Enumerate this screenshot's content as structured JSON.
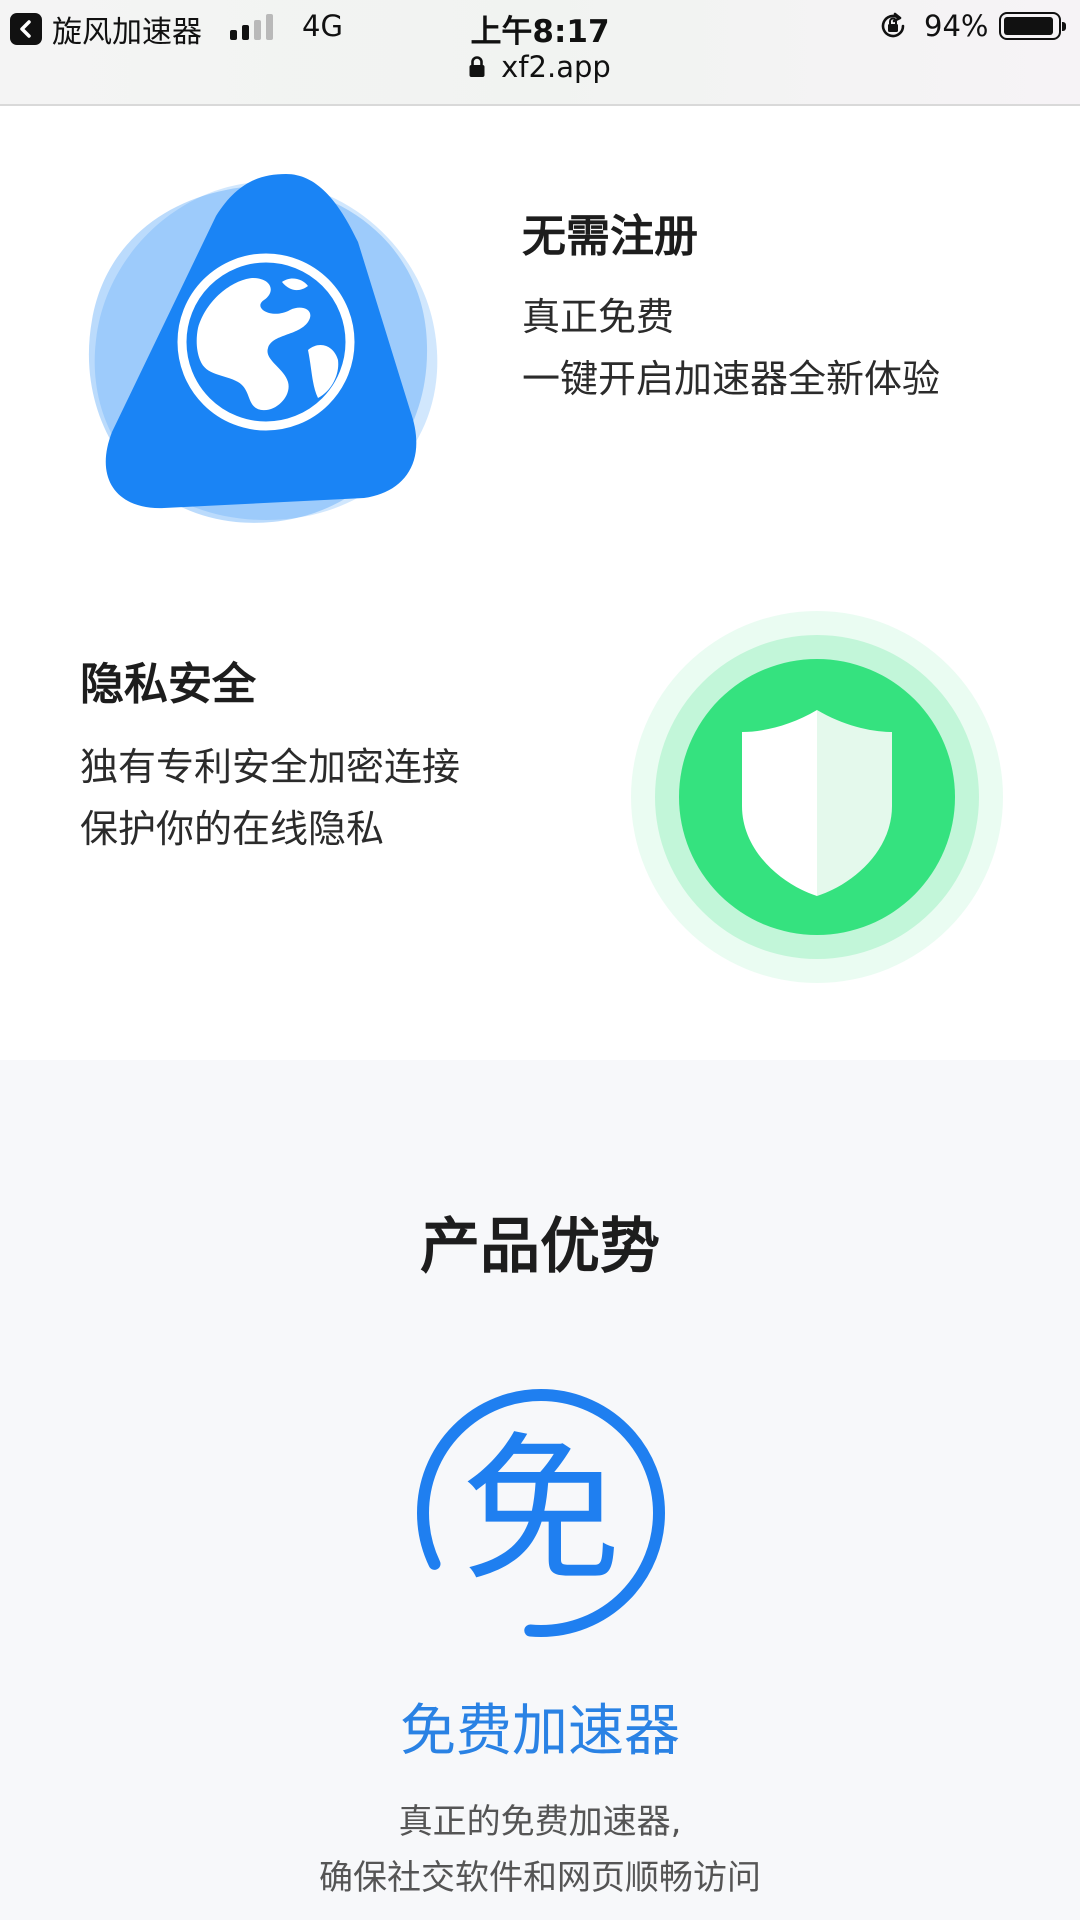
{
  "status_bar": {
    "back_app_label": "旋风加速器",
    "network": "4G",
    "time": "上午8:17",
    "url": "xf2.app",
    "battery_percent_text": "94%",
    "battery_level": 0.94,
    "signal_bars_active": 2,
    "signal_bars_total": 4
  },
  "features": [
    {
      "title": "无需注册",
      "lines": [
        "真正免费",
        "一键开启加速器全新体验"
      ],
      "icon": "globe-icon"
    },
    {
      "title": "隐私安全",
      "lines": [
        "独有专利安全加密连接",
        "保护你的在线隐私"
      ],
      "icon": "shield-icon"
    }
  ],
  "advantages": {
    "heading": "产品优势",
    "item": {
      "icon_char": "免",
      "icon": "free-badge-icon",
      "title": "免费加速器",
      "lines": [
        "真正的免费加速器,",
        "确保社交软件和网页顺畅访问"
      ]
    }
  },
  "colors": {
    "primary_blue": "#1a84f5",
    "accent_green": "#35e27f",
    "title_blue": "#2a82e4"
  }
}
